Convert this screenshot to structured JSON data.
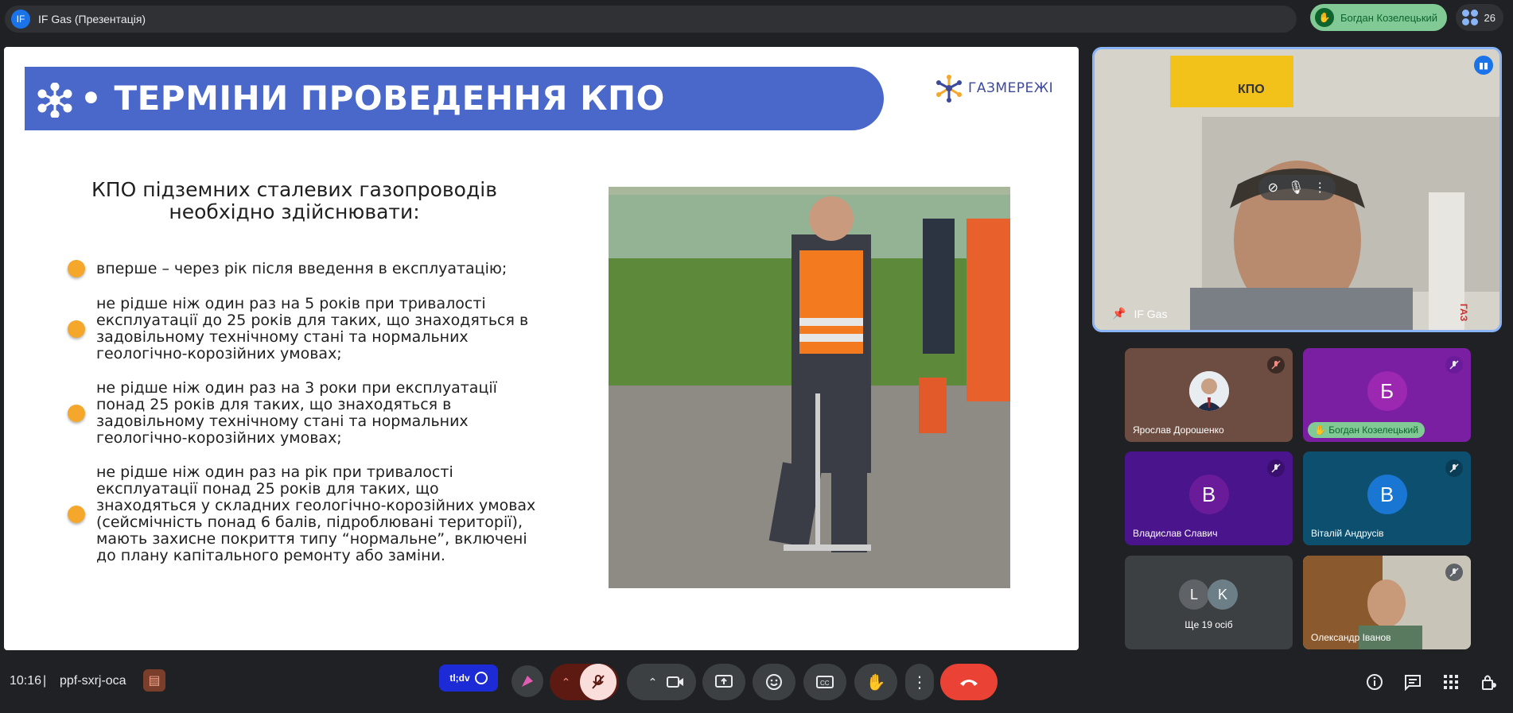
{
  "meeting": {
    "presenter_initials": "IF",
    "presentation_title": "IF Gas (Презентація)",
    "active_speaker": "Богдан Козелецький",
    "participant_count": "26",
    "time": "10:16",
    "separator": "|",
    "meeting_code": "ppf-sxrj-oca"
  },
  "slide": {
    "title": "• ТЕРМІНИ ПРОВЕДЕННЯ КПО",
    "logo_text": "ГАЗМЕРЕЖІ",
    "subtitle": "КПО підземних сталевих газопроводів необхідно здійснювати:",
    "bullets": [
      "вперше – через рік після введення в експлуатацію;",
      "не рідше ніж один раз на 5 років при тривалості експлуатації до 25 років для таких, що знаходяться в задовільному технічному стані та нормальних геологічно-корозійних умовах;",
      "не рідше ніж один раз на 3 роки при експлуатації понад 25 років для таких, що знаходяться в задовільному технічному стані та нормальних геологічно-корозійних умовах;",
      "не рідше ніж один раз на рік при тривалості експлуатації понад 25 років для таких, що знаходяться у складних геологічно-корозійних умовах (сейсмічність понад 6 балів, підроблювані території), мають захисне покриття типу “нормальне”, включені до плану капітального ремонту або заміни."
    ]
  },
  "video": {
    "main_tile_name": "IF Gas",
    "background_sign": "КПО",
    "background_cabinet": "ГАЗ",
    "tiles": [
      {
        "name": "Ярослав Дорошенко",
        "initial": "",
        "bg": "#6d4c41"
      },
      {
        "name": "Богдан Козелецький",
        "initial": "Б",
        "bg": "#7b1fa2"
      },
      {
        "name": "Владислав Славич",
        "initial": "В",
        "bg": "#4a148c"
      },
      {
        "name": "Віталій Андрусів",
        "initial": "В",
        "bg": "#0d4f6e"
      },
      {
        "name": "Ще 19 осіб",
        "initial": "",
        "bg": "#3c4043"
      },
      {
        "name": "Олександр Іванов",
        "initial": "",
        "bg": "#7d6a52"
      }
    ],
    "more_initials": [
      "L",
      "K"
    ]
  },
  "controls": {
    "tldv_label": "tl;dv"
  },
  "colors": {
    "banner": "#4a68c9",
    "bullet": "#f4a72a",
    "end_call": "#ea4335",
    "mic_off": "#f9dedc"
  }
}
